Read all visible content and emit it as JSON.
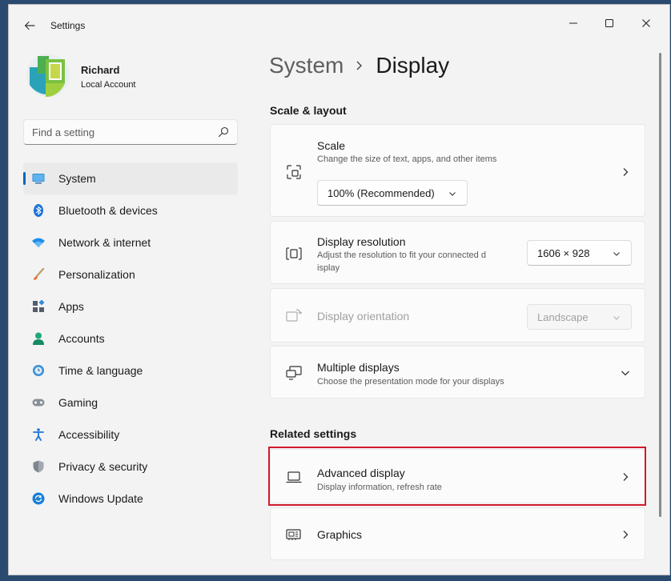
{
  "window": {
    "title": "Settings"
  },
  "user": {
    "name": "Richard",
    "account_type": "Local Account"
  },
  "search": {
    "placeholder": "Find a setting"
  },
  "sidebar": {
    "items": [
      {
        "label": "System",
        "icon": "system-icon",
        "active": true
      },
      {
        "label": "Bluetooth & devices",
        "icon": "bluetooth-icon"
      },
      {
        "label": "Network & internet",
        "icon": "wifi-icon"
      },
      {
        "label": "Personalization",
        "icon": "brush-icon"
      },
      {
        "label": "Apps",
        "icon": "apps-icon"
      },
      {
        "label": "Accounts",
        "icon": "person-icon"
      },
      {
        "label": "Time & language",
        "icon": "globe-clock-icon"
      },
      {
        "label": "Gaming",
        "icon": "gamepad-icon"
      },
      {
        "label": "Accessibility",
        "icon": "accessibility-icon"
      },
      {
        "label": "Privacy & security",
        "icon": "shield-icon"
      },
      {
        "label": "Windows Update",
        "icon": "update-icon"
      }
    ]
  },
  "breadcrumb": {
    "parent": "System",
    "current": "Display"
  },
  "scale_layout": {
    "heading": "Scale & layout",
    "scale": {
      "title": "Scale",
      "description": "Change the size of text, apps, and other items",
      "value": "100% (Recommended)"
    },
    "resolution": {
      "title": "Display resolution",
      "description_line1": "Adjust the resolution to fit your connected d",
      "description_line2": "isplay",
      "value": "1606 × 928"
    },
    "orientation": {
      "title": "Display orientation",
      "value": "Landscape",
      "disabled": true
    },
    "multiple": {
      "title": "Multiple displays",
      "description": "Choose the presentation mode for your displays"
    }
  },
  "related": {
    "heading": "Related settings",
    "advanced": {
      "title": "Advanced display",
      "description": "Display information, refresh rate"
    },
    "graphics": {
      "title": "Graphics"
    }
  },
  "colors": {
    "accent": "#0067c0",
    "highlight": "#d11a2a",
    "background": "#f3f3f3"
  }
}
